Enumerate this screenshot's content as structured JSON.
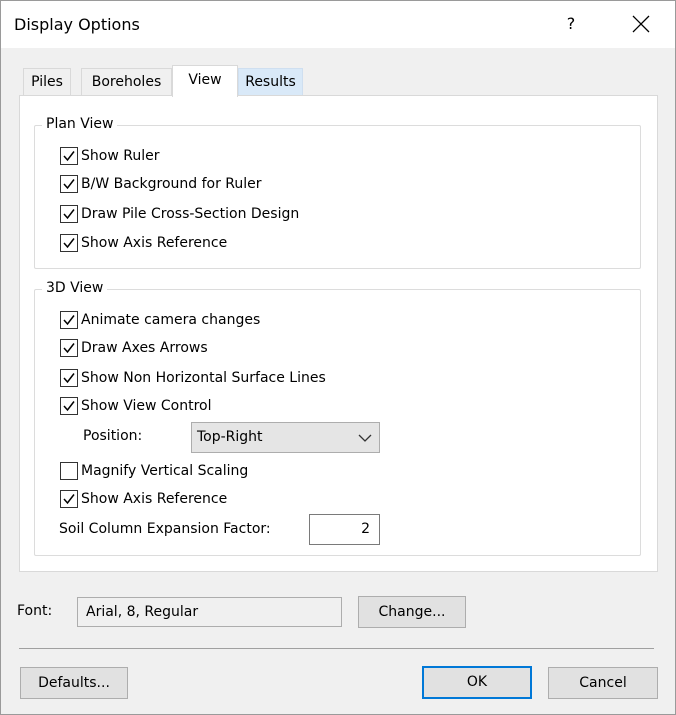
{
  "window": {
    "title": "Display Options",
    "help_glyph": "?"
  },
  "tabs": [
    {
      "label": "Piles"
    },
    {
      "label": "Boreholes"
    },
    {
      "label": "View"
    },
    {
      "label": "Results"
    }
  ],
  "plan_view": {
    "label": "Plan View",
    "items": [
      {
        "label": "Show Ruler",
        "checked": true
      },
      {
        "label": "B/W Background for Ruler",
        "checked": true
      },
      {
        "label": "Draw Pile Cross-Section Design",
        "checked": true
      },
      {
        "label": "Show Axis Reference",
        "checked": true
      }
    ]
  },
  "view_3d": {
    "label": "3D View",
    "items": [
      {
        "label": "Animate camera changes",
        "checked": true
      },
      {
        "label": "Draw Axes Arrows",
        "checked": true
      },
      {
        "label": "Show Non Horizontal Surface Lines",
        "checked": true
      },
      {
        "label": "Show View Control",
        "checked": true
      },
      {
        "label": "Magnify Vertical Scaling",
        "checked": false
      },
      {
        "label": "Show Axis Reference",
        "checked": true
      }
    ],
    "position_label": "Position:",
    "position_value": "Top-Right",
    "expansion_label": "Soil Column Expansion Factor:",
    "expansion_value": "2"
  },
  "font": {
    "label": "Font:",
    "value": "Arial, 8, Regular",
    "change_button": "Change..."
  },
  "buttons": {
    "defaults": "Defaults...",
    "ok": "OK",
    "cancel": "Cancel"
  },
  "colors": {
    "accent": "#0078d7",
    "results_tab": "#d9e9f8"
  }
}
